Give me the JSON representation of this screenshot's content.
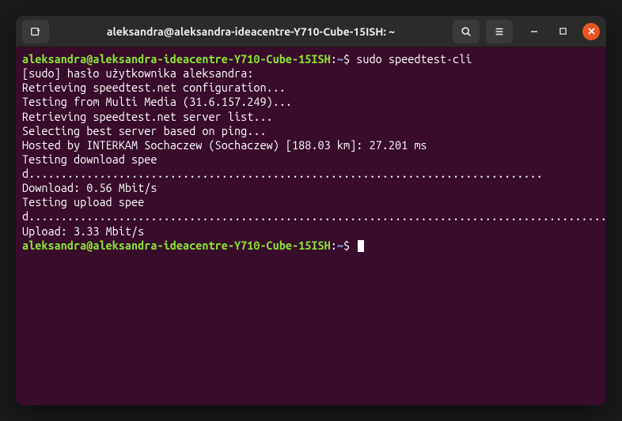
{
  "titlebar": {
    "title": "aleksandra@aleksandra-ideacentre-Y710-Cube-15ISH: ~"
  },
  "prompt": {
    "user_host": "aleksandra@aleksandra-ideacentre-Y710-Cube-15ISH",
    "path": "~",
    "symbol": "$"
  },
  "lines": {
    "cmd1": " sudo speedtest-cli",
    "l1": "[sudo] hasło użytkownika aleksandra: ",
    "l2": "Retrieving speedtest.net configuration...",
    "l3": "Testing from Multi Media (31.6.157.249)...",
    "l4": "Retrieving speedtest.net server list...",
    "l5": "Selecting best server based on ping...",
    "l6": "Hosted by INTERKAM Sochaczew (Sochaczew) [188.03 km]: 27.201 ms",
    "l7": "Testing download speed................................................................................",
    "l8": "Download: 0.56 Mbit/s",
    "l9": "Testing upload speed................................................................................................",
    "l10": "Upload: 3.33 Mbit/s"
  }
}
